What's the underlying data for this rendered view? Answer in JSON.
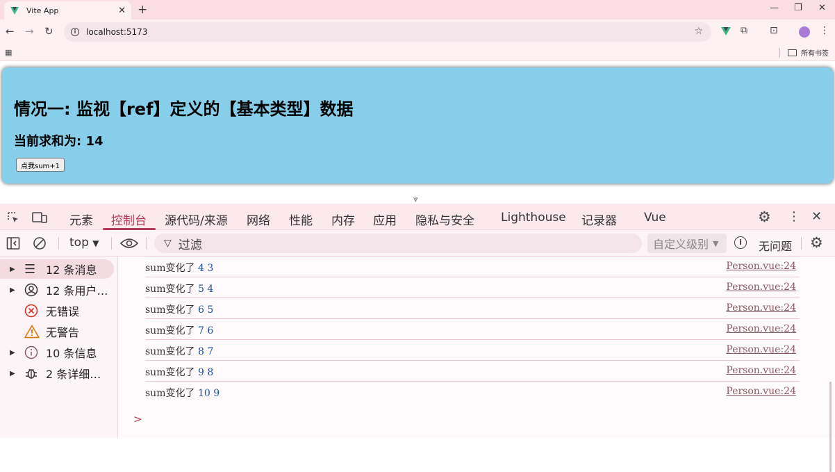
{
  "browser": {
    "tab_title": "Vite App",
    "tab_close": "✕",
    "new_tab": "+",
    "url": "localhost:5173",
    "bookmark_folder": "所有书签",
    "window_controls": [
      "—",
      "❐",
      "✕"
    ]
  },
  "page": {
    "heading": "情况一: 监视【ref】定义的【基本类型】数据",
    "sum_label": "当前求和为: 14",
    "button_label": "点我sum+1",
    "bg_color": "#87ceeb"
  },
  "devtools": {
    "tabs": [
      "元素",
      "控制台",
      "源代码/来源",
      "网络",
      "性能",
      "内存",
      "应用",
      "隐私与安全",
      "Lighthouse",
      "记录器",
      "Vue"
    ],
    "active_tab": "控制台",
    "context": "top",
    "filter_placeholder": "过滤",
    "level": "自定义级别",
    "issues": "无问题",
    "accent_color": "#b43c59"
  },
  "sidebar": {
    "items": [
      {
        "label": "12 条消息",
        "icon": "list-icon",
        "expandable": true
      },
      {
        "label": "12 条用户…",
        "icon": "user-icon",
        "expandable": true
      },
      {
        "label": "无错误",
        "icon": "error-icon",
        "expandable": false
      },
      {
        "label": "无警告",
        "icon": "warning-icon",
        "expandable": false
      },
      {
        "label": "10 条信息",
        "icon": "info-icon",
        "expandable": true
      },
      {
        "label": "2 条详细…",
        "icon": "bug-icon",
        "expandable": true
      }
    ]
  },
  "console": {
    "logs": [
      {
        "text": "sum变化了",
        "new": "4",
        "old": "3",
        "source": "Person.vue:24"
      },
      {
        "text": "sum变化了",
        "new": "5",
        "old": "4",
        "source": "Person.vue:24"
      },
      {
        "text": "sum变化了",
        "new": "6",
        "old": "5",
        "source": "Person.vue:24"
      },
      {
        "text": "sum变化了",
        "new": "7",
        "old": "6",
        "source": "Person.vue:24"
      },
      {
        "text": "sum变化了",
        "new": "8",
        "old": "7",
        "source": "Person.vue:24"
      },
      {
        "text": "sum变化了",
        "new": "9",
        "old": "8",
        "source": "Person.vue:24"
      },
      {
        "text": "sum变化了",
        "new": "10",
        "old": "9",
        "source": "Person.vue:24"
      }
    ],
    "prompt": ">"
  }
}
